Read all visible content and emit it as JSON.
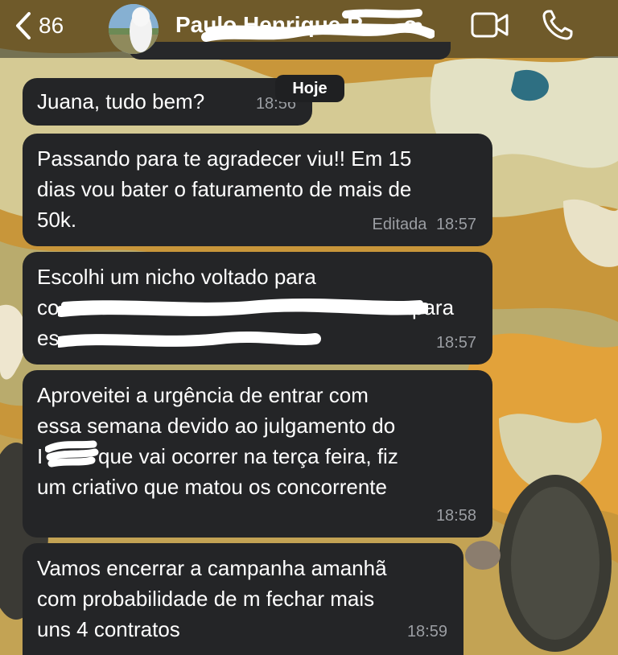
{
  "header": {
    "back_count": "86",
    "contact_name": "Paulo Henrique R",
    "contact_name_suffix": "o"
  },
  "date_separator": "Hoje",
  "messages": [
    {
      "text": "Juana, tudo bem?",
      "time": "18:56",
      "edited": ""
    },
    {
      "text": "Passando para te agradecer viu!! Em 15\ndias vou bater o faturamento de mais de\n50k.",
      "time": "18:57",
      "edited": "Editada"
    },
    {
      "line1": "Escolhi um nicho voltado para",
      "line2_start": "co",
      "line2_end": "para",
      "line3_start": "es",
      "line3_end": ".",
      "time": "18:57",
      "edited": ""
    },
    {
      "line1": "Aproveitei a urgência de entrar com",
      "line2": "essa semana devido ao julgamento do",
      "line3_start": "I",
      "line3_end": "que vai ocorrer na terça feira, fiz",
      "line4": "um criativo que matou os concorrente",
      "time": "18:58",
      "edited": ""
    },
    {
      "text": "Vamos encerrar a campanha amanhã\ncom probabilidade de m fechar mais\nuns 4 contratos",
      "time": "18:59",
      "edited": ""
    }
  ]
}
